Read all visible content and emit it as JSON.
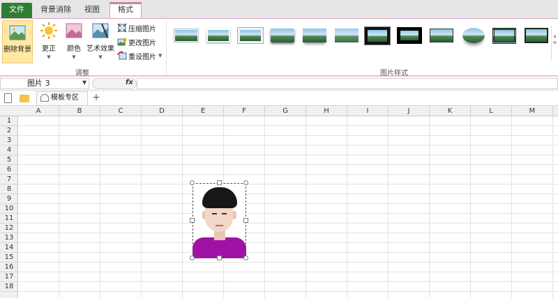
{
  "tabs": {
    "file": "文件",
    "remove_bg": "背景消除",
    "view": "视图",
    "format": "格式"
  },
  "ribbon": {
    "remove_background": "删除背景",
    "corrections": "更正",
    "color": "颜色",
    "artistic_effects": "艺术效果",
    "compress_picture": "压缩图片",
    "change_picture": "更改图片",
    "reset_picture": "重设图片",
    "adjust_group": "调整",
    "picture_styles_group": "图片样式"
  },
  "formula_bar": {
    "name_box_value": "图片 3",
    "fx": "fx"
  },
  "doc_tabs": {
    "template_zone": "模板专区",
    "add": "+"
  },
  "columns": [
    "A",
    "B",
    "C",
    "D",
    "E",
    "F",
    "G",
    "H",
    "I",
    "J",
    "K",
    "L",
    "M"
  ],
  "rows": [
    "1",
    "2",
    "3",
    "4",
    "5",
    "6",
    "7",
    "8",
    "9",
    "10",
    "11",
    "12",
    "13",
    "14",
    "15",
    "16",
    "17",
    "18"
  ],
  "colors": {
    "file_tab": "#2f7d32",
    "format_tab_accent": "#d37da9",
    "shirt": "#a012a6",
    "remove_bg_highlight": "#ffe9a5"
  }
}
